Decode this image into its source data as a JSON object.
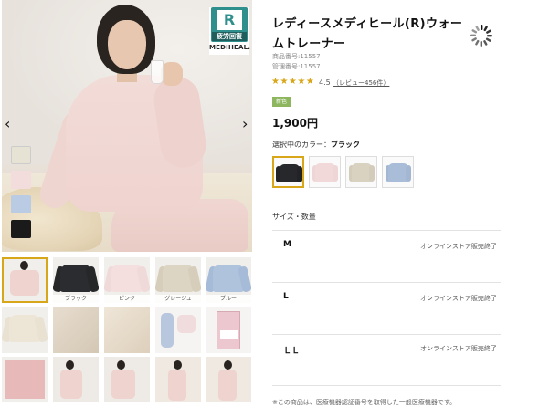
{
  "product": {
    "title": "レディースメディヒール(R)ウォームトレーナー",
    "product_number_label": "商品番号:11557",
    "management_number_label": "管理番号:11557",
    "stars": "★★★★★",
    "rating": "4.5",
    "review_link": "（レビュー456件）",
    "new_badge": "新色",
    "price": "1,900円"
  },
  "badge": {
    "letter": "R",
    "caption": "疲労回復",
    "brand": "MEDIHEAL."
  },
  "carousel": {
    "prev_icon": "‹",
    "next_icon": "›"
  },
  "colors": {
    "label_prefix": "選択中のカラー：",
    "selected": "ブラック",
    "swatches": [
      {
        "name": "black",
        "hex": "#26282b"
      },
      {
        "name": "pink",
        "hex": "#f1d9d9"
      },
      {
        "name": "greige",
        "hex": "#d9d2c1"
      },
      {
        "name": "blue",
        "hex": "#a9bdd8"
      }
    ]
  },
  "thumbs": {
    "captions": [
      "ブラック",
      "ピンク",
      "グレージュ",
      "ブルー"
    ]
  },
  "sizes": {
    "heading": "サイズ・数量",
    "items": [
      {
        "name": "M",
        "status": "オンラインストア販売終了"
      },
      {
        "name": "L",
        "status": "オンラインストア販売終了"
      },
      {
        "name": "ＬＬ",
        "status": "オンラインストア販売終了"
      }
    ]
  },
  "footer_text": "※この商品は、医療機器認証番号を取得した一般医療機器です。"
}
